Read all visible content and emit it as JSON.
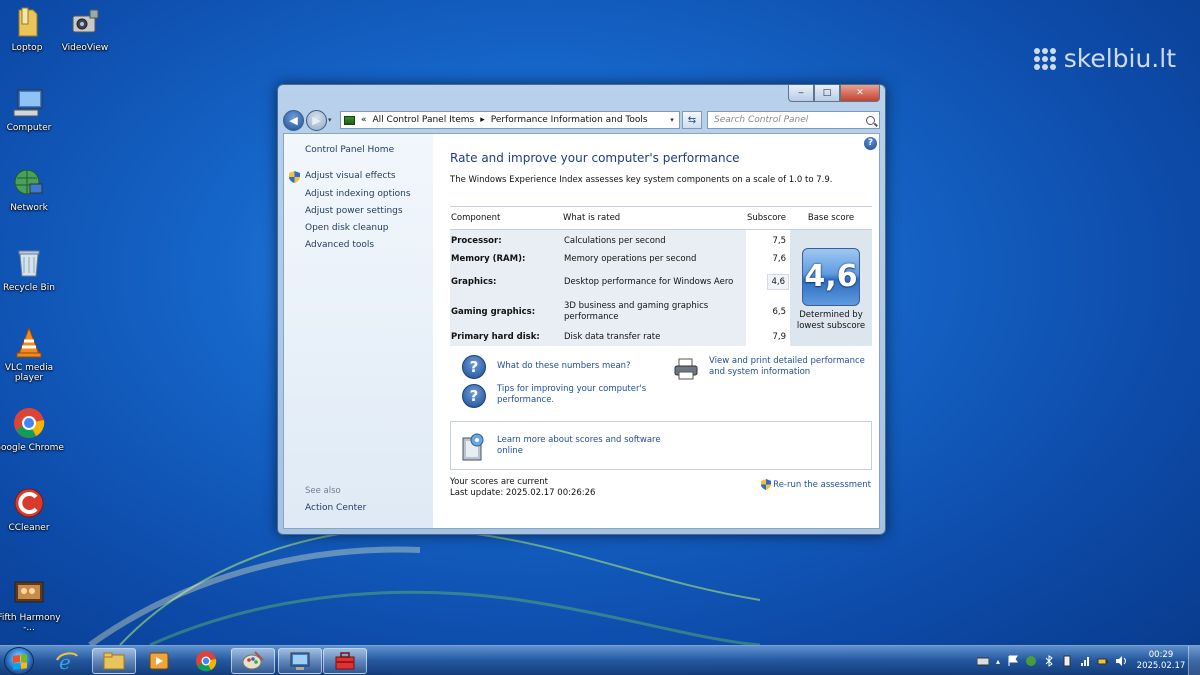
{
  "watermark": "skelbiu.lt",
  "desktop": {
    "icons": [
      {
        "label": "Loptop"
      },
      {
        "label": "VideoView"
      },
      {
        "label": "Computer"
      },
      {
        "label": "Network"
      },
      {
        "label": "Recycle Bin"
      },
      {
        "label": "VLC media player"
      },
      {
        "label": "Google Chrome"
      },
      {
        "label": "CCleaner"
      },
      {
        "label": "Fifth Harmony -..."
      }
    ]
  },
  "window": {
    "caption_buttons": {
      "minimize": "‒",
      "maximize": "□",
      "close": "✕"
    },
    "address": {
      "chevron": "«",
      "crumb1": "All Control Panel Items",
      "separator": "▸",
      "crumb2": "Performance Information and Tools"
    },
    "search": {
      "placeholder": "Search Control Panel"
    },
    "left_pane": {
      "home": "Control Panel Home",
      "links": [
        "Adjust visual effects",
        "Adjust indexing options",
        "Adjust power settings",
        "Open disk cleanup",
        "Advanced tools"
      ],
      "see_also_title": "See also",
      "see_also_links": [
        "Action Center"
      ]
    },
    "main": {
      "help": "?",
      "title": "Rate and improve your computer's performance",
      "description": "The Windows Experience Index assesses key system components on a scale of 1.0 to 7.9.",
      "table": {
        "headers": {
          "component": "Component",
          "rated": "What is rated",
          "subscore": "Subscore",
          "base": "Base score"
        },
        "rows": [
          {
            "component": "Processor:",
            "rated": "Calculations per second",
            "subscore": "7,5"
          },
          {
            "component": "Memory (RAM):",
            "rated": "Memory operations per second",
            "subscore": "7,6"
          },
          {
            "component": "Graphics:",
            "rated": "Desktop performance for Windows Aero",
            "subscore": "4,6"
          },
          {
            "component": "Gaming graphics:",
            "rated": "3D business and gaming graphics performance",
            "subscore": "6,5"
          },
          {
            "component": "Primary hard disk:",
            "rated": "Disk data transfer rate",
            "subscore": "7,9"
          }
        ],
        "base_score": "4,6",
        "base_caption": "Determined by lowest subscore"
      },
      "links": {
        "numbers_meaning": "What do these numbers mean?",
        "tips": "Tips for improving your computer's performance.",
        "print": "View and print detailed performance and system information",
        "learn_more": "Learn more about scores and software online"
      },
      "status": {
        "current": "Your scores are current",
        "last_update": "Last update: 2025.02.17 00:26:26",
        "rerun": "Re-run the assessment"
      }
    }
  },
  "taskbar": {
    "clock": {
      "time": "00:29",
      "date": "2025.02.17"
    },
    "tray_chevron": "▴"
  }
}
